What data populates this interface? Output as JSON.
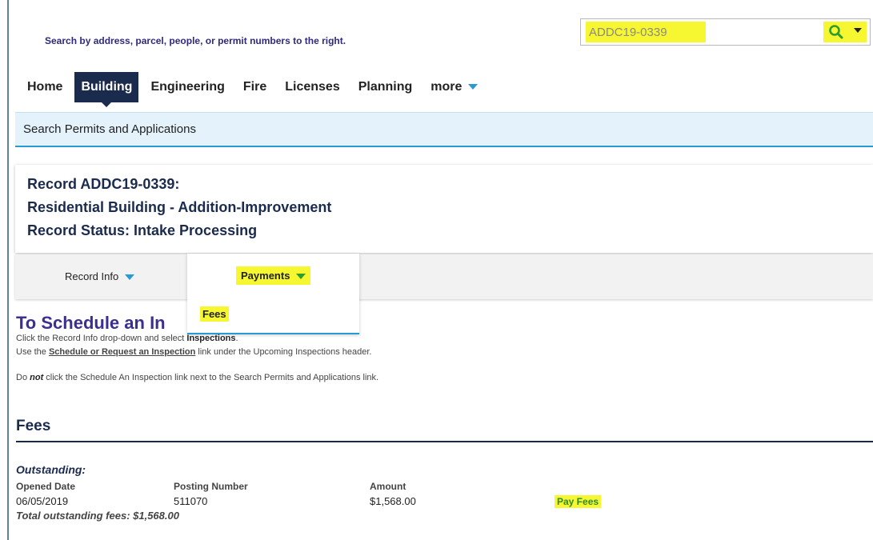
{
  "header": {
    "hint": "Search by address, parcel, people, or permit numbers to the right.",
    "search_value": "ADDC19-0339",
    "icons": {
      "search": "search-icon",
      "menu": "chevron-down-icon"
    }
  },
  "nav": {
    "items": [
      "Home",
      "Building",
      "Engineering",
      "Fire",
      "Licenses",
      "Planning",
      "more"
    ],
    "active": "Building"
  },
  "subnav": {
    "label": "Search Permits and Applications"
  },
  "record": {
    "line1": "Record ADDC19-0339:",
    "line2": "Residential Building - Addition-Improvement",
    "line3": "Record Status: Intake Processing"
  },
  "tabs": {
    "record_info": "Record Info",
    "payments": "Payments",
    "payments_menu": [
      "Fees"
    ]
  },
  "schedule": {
    "title": "To Schedule an In",
    "line1_pre": "Click the Record Info drop-down and select ",
    "line1_bold": "Inspections",
    "line1_post": ".",
    "line2_pre": "Use the ",
    "line2_link": "Schedule or Request an Inspection",
    "line2_post": " link under the Upcoming Inspections header.",
    "line3_pre": "Do ",
    "line3_em": "not",
    "line3_post": " click the Schedule An Inspection link next to the Search Permits and Applications link."
  },
  "fees": {
    "heading": "Fees",
    "outstanding_label": "Outstanding:",
    "columns": [
      "Opened Date",
      "Posting Number",
      "Amount"
    ],
    "row": {
      "opened_date": "06/05/2019",
      "posting_number": "511070",
      "amount": "$1,568.00"
    },
    "pay_label": "Pay Fees",
    "total": "Total outstanding fees: $1,568.00"
  },
  "colors": {
    "highlight": "#f6f631",
    "navy": "#1a2b4e",
    "accent": "#2a9ad6",
    "title_purple": "#3b2f8f",
    "pay_green": "#2e8a2e"
  }
}
